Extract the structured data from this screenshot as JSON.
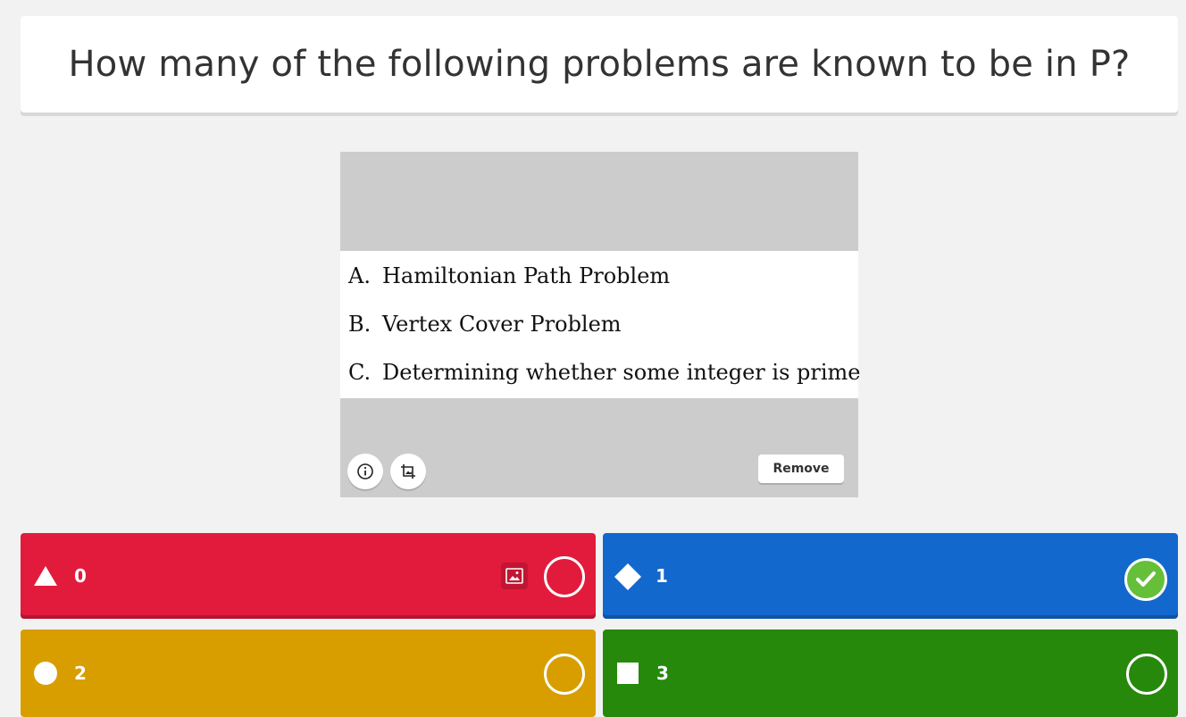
{
  "question": {
    "text": "How many of the following problems are known to be in P?"
  },
  "media": {
    "lines": [
      {
        "letter": "A.",
        "text": "Hamiltonian Path Problem"
      },
      {
        "letter": "B.",
        "text": "Vertex Cover Problem"
      },
      {
        "letter": "C.",
        "text": "Determining whether some integer is prime"
      }
    ],
    "remove_label": "Remove",
    "info_icon": "info-icon",
    "crop_icon": "crop-icon"
  },
  "answers": [
    {
      "shape": "triangle",
      "text": "0",
      "color": "#e21b3c",
      "correct": false
    },
    {
      "shape": "diamond",
      "text": "1",
      "color": "#1368ce",
      "correct": true
    },
    {
      "shape": "circle",
      "text": "2",
      "color": "#d89e00",
      "correct": false
    },
    {
      "shape": "square",
      "text": "3",
      "color": "#26890c",
      "correct": false
    }
  ],
  "colors": {
    "background": "#f2f2f2",
    "correct_check": "#66bf39"
  }
}
